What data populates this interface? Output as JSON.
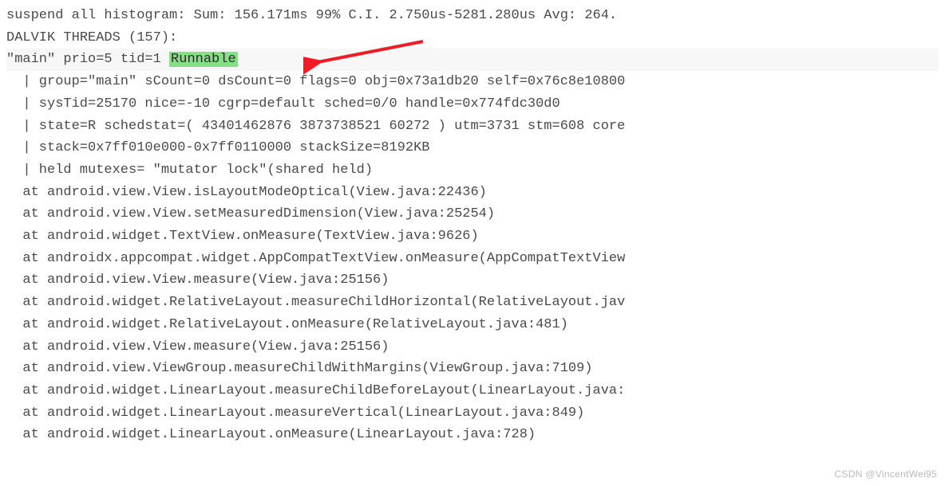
{
  "header": {
    "line1": "suspend all histogram:  Sum: 156.171ms 99% C.I. 2.750us-5281.280us Avg: 264.",
    "line2": "DALVIK THREADS (157):"
  },
  "thread": {
    "prefix": "\"main\" prio=5 tid=1 ",
    "state": "Runnable",
    "detail_lines": [
      "| group=\"main\" sCount=0 dsCount=0 flags=0 obj=0x73a1db20 self=0x76c8e10800",
      "| sysTid=25170 nice=-10 cgrp=default sched=0/0 handle=0x774fdc30d0",
      "| state=R schedstat=( 43401462876 3873738521 60272 ) utm=3731 stm=608 core",
      "| stack=0x7ff010e000-0x7ff0110000 stackSize=8192KB",
      "| held mutexes= \"mutator lock\"(shared held)"
    ],
    "stack": [
      "at android.view.View.isLayoutModeOptical(View.java:22436)",
      "at android.view.View.setMeasuredDimension(View.java:25254)",
      "at android.widget.TextView.onMeasure(TextView.java:9626)",
      "at androidx.appcompat.widget.AppCompatTextView.onMeasure(AppCompatTextView",
      "at android.view.View.measure(View.java:25156)",
      "at android.widget.RelativeLayout.measureChildHorizontal(RelativeLayout.jav",
      "at android.widget.RelativeLayout.onMeasure(RelativeLayout.java:481)",
      "at android.view.View.measure(View.java:25156)",
      "at android.view.ViewGroup.measureChildWithMargins(ViewGroup.java:7109)",
      "at android.widget.LinearLayout.measureChildBeforeLayout(LinearLayout.java:",
      "at android.widget.LinearLayout.measureVertical(LinearLayout.java:849)",
      "at android.widget.LinearLayout.onMeasure(LinearLayout.java:728)"
    ]
  },
  "annotation": {
    "arrow_color": "#ee1c25"
  },
  "watermark": "CSDN @VincentWei95"
}
